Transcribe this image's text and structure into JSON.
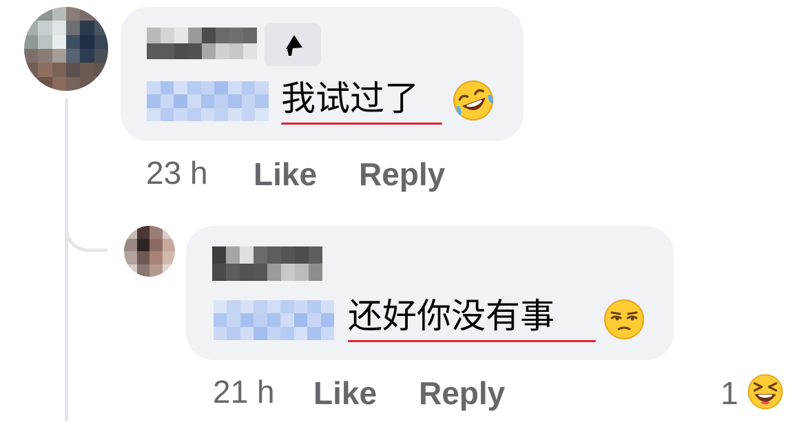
{
  "comments": [
    {
      "author_label": "",
      "badge_icon": "top-fan-megaphone-icon",
      "mention_label": "",
      "text": "我试过了",
      "emoji": "rolling-on-floor-laughing-emoji",
      "time": "23 h",
      "like_label": "Like",
      "reply_label": "Reply"
    },
    {
      "author_label": "",
      "mention_label": "",
      "text": "还好你没有事",
      "emoji": "unamused-face-emoji",
      "time": "21 h",
      "like_label": "Like",
      "reply_label": "Reply",
      "reaction_count": "1",
      "reaction_emoji": "grinning-squinting-face-emoji"
    }
  ],
  "colors": {
    "bubble": "#f0f2f5",
    "meta_text": "#65676b",
    "spellcheck_underline": "#e02233",
    "mention": "#a9c2f0"
  }
}
